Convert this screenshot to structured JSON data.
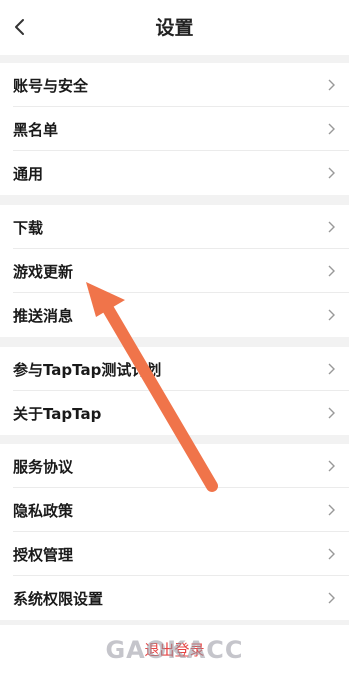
{
  "header": {
    "title": "设置",
    "back_icon": "chevron-left-icon"
  },
  "groups": [
    {
      "items": [
        "账号与安全",
        "黑名单",
        "通用"
      ]
    },
    {
      "items": [
        "下载",
        "游戏更新",
        "推送消息"
      ]
    },
    {
      "items": [
        "参与TapTap测试计划",
        "关于TapTap"
      ]
    },
    {
      "items": [
        "服务协议",
        "隐私政策",
        "授权管理",
        "系统权限设置"
      ]
    }
  ],
  "logout": {
    "label": "退出登录"
  },
  "watermark": {
    "text": "GAOKACC"
  },
  "colors": {
    "accent_arrow": "#f0744a",
    "logout": "#e64545",
    "background": "#f2f2f2"
  }
}
